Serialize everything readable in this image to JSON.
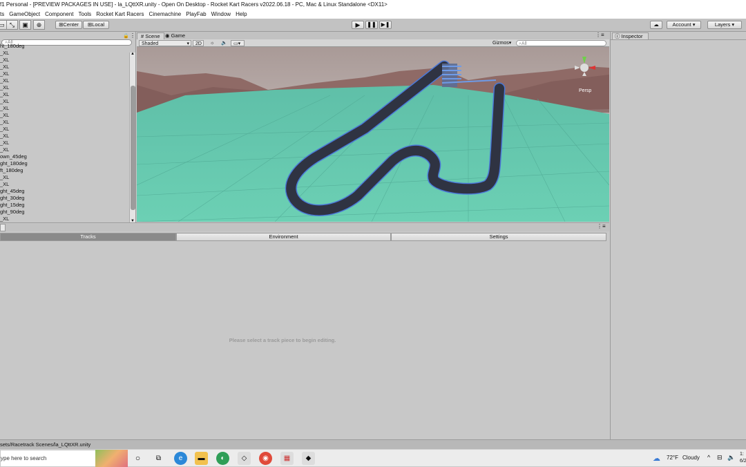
{
  "window": {
    "title": "f1 Personal - [PREVIEW PACKAGES IN USE] - la_LQttXR.unity - Open On Desktop - Rocket Kart Racers v2022.06.18 - PC, Mac & Linux Standalone <DX11>"
  },
  "menu": [
    "ts",
    "GameObject",
    "Component",
    "Tools",
    "Rocket Kart Racers",
    "Cinemachine",
    "PlayFab",
    "Window",
    "Help"
  ],
  "toolbar": {
    "center_label": "Center",
    "local_label": "Local",
    "account_label": "Account",
    "layers_label": "Layers"
  },
  "hierarchy": {
    "search_placeholder": "All",
    "items": [
      "ht_180deg",
      "_XL",
      "_XL",
      "_XL",
      "_XL",
      "_XL",
      "_XL",
      "_XL",
      "_XL",
      "_XL",
      "_XL",
      "_XL",
      "_XL",
      "_XL",
      "_XL",
      "_XL",
      "own_45deg",
      "ght_180deg",
      "ft_180deg",
      "_XL",
      "_XL",
      "ght_45deg",
      "ght_30deg",
      "ght_15deg",
      "ght_90deg",
      "_XL"
    ]
  },
  "scene": {
    "tab_scene": "Scene",
    "tab_game": "Game",
    "shading_mode": "Shaded",
    "mode_2d": "2D",
    "gizmos_label": "Gizmos",
    "search_placeholder": "All",
    "projection_label": "Persp",
    "colors": {
      "ground": "#5fbfa8",
      "mountains": "#8f6a66",
      "track": "#2f3342",
      "track_outline": "#4a78d8"
    }
  },
  "track_editor": {
    "tabs": [
      "Tracks",
      "Environment",
      "Settings"
    ],
    "active_tab": "Tracks",
    "empty_message": "Please select a track piece to begin editing."
  },
  "inspector": {
    "tab_label": "Inspector"
  },
  "status": {
    "path_text": "sets/Racetrack Scenes/la_LQttXR.unity"
  },
  "taskbar": {
    "search_placeholder": "ype here to search",
    "weather_temp": "72°F",
    "weather_condition": "Cloudy",
    "clock_time": "1:",
    "clock_date": "6/2"
  }
}
